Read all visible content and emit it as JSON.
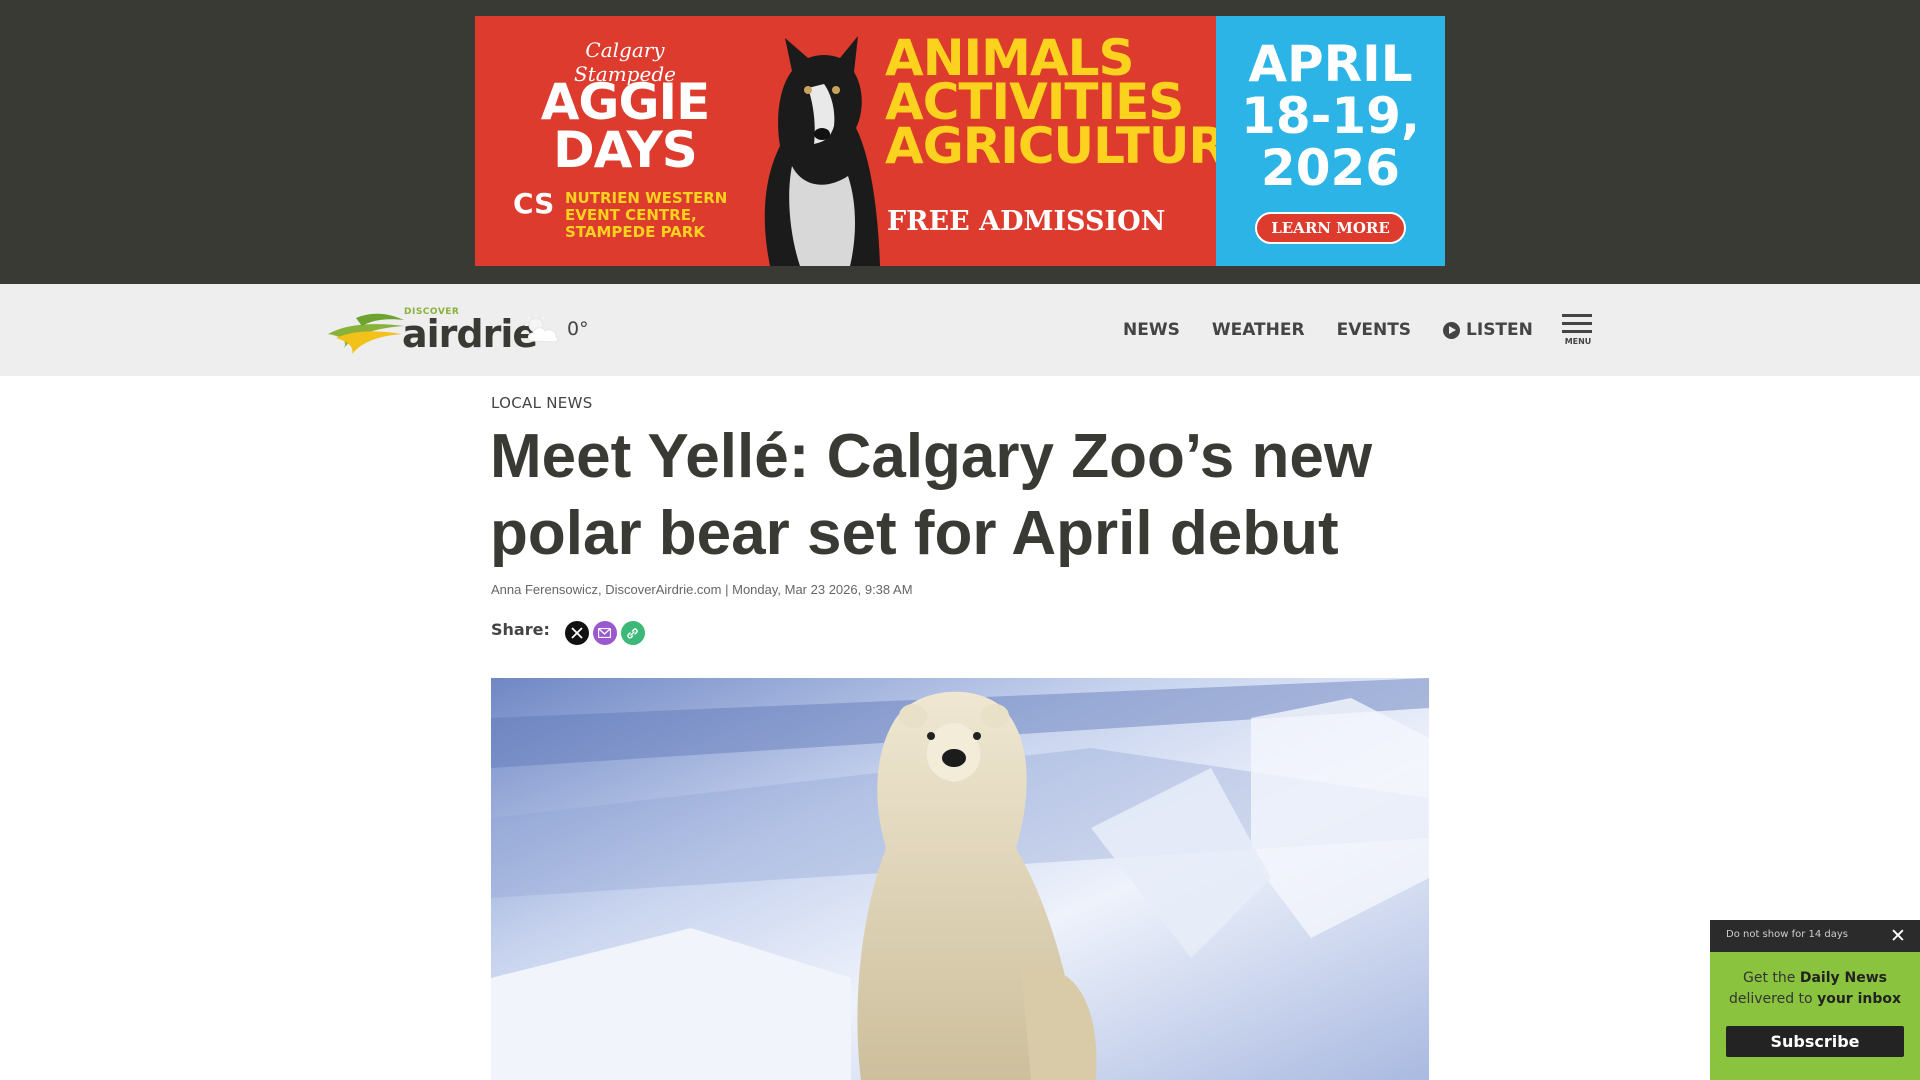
{
  "ad": {
    "stampede": "Calgary Stampede",
    "aggie_line1": "AGGIE",
    "aggie_line2": "DAYS",
    "cs": "CS",
    "venue_line1": "NUTRIEN WESTERN",
    "venue_line2": "EVENT CENTRE,",
    "venue_line3": "STAMPEDE PARK",
    "big_line1": "ANIMALS",
    "big_line2": "ACTIVITIES",
    "big_line3": "AGRICULTURE",
    "free": "FREE ADMISSION",
    "date_line1": "APRIL",
    "date_line2": "18-19,",
    "date_line3": "2026",
    "learn_more": "LEARN MORE",
    "colors": {
      "red": "#dc3b2e",
      "yellow": "#fbd21d",
      "blue": "#2cb4e6"
    }
  },
  "header": {
    "logo_small": "DISCOVER",
    "logo_word": "airdrie",
    "weather_icon": "partly-cloudy-icon",
    "temperature": "0°",
    "nav": [
      {
        "label": "NEWS"
      },
      {
        "label": "WEATHER"
      },
      {
        "label": "EVENTS"
      },
      {
        "label": "LISTEN",
        "icon": "play-icon"
      }
    ],
    "menu_label": "MENU"
  },
  "article": {
    "category": "LOCAL NEWS",
    "headline": "Meet Yellé: Calgary Zoo’s new polar bear set for April debut",
    "author": "Anna Ferensowicz",
    "source": "DiscoverAirdrie.com",
    "date": "Monday, Mar 23 2026, 9:38 AM",
    "share_label": "Share:",
    "share_icons": [
      "x-icon",
      "mail-icon",
      "link-icon"
    ]
  },
  "popup": {
    "dont_show": "Do not show for 14 days",
    "text_pre": "Get the ",
    "text_bold1": "Daily News",
    "text_mid": "delivered to ",
    "text_bold2": "your inbox",
    "subscribe": "Subscribe"
  }
}
